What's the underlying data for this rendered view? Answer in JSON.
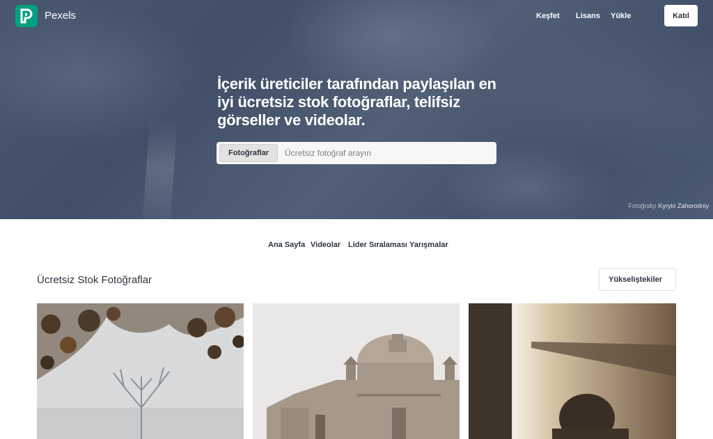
{
  "brand": {
    "name": "Pexels",
    "accent": "#05a081"
  },
  "topnav": {
    "links": [
      "Keşfet",
      "Lisans",
      "Yükle"
    ],
    "join_label": "Katıl"
  },
  "hero": {
    "headline": "İçerik üreticiler tarafından paylaşılan en iyi ücretsiz stok fotoğraflar, telifsiz görseller ve videolar.",
    "search": {
      "type_label": "Fotoğraflar",
      "placeholder": "Ücretsiz fotoğraf arayın",
      "value": ""
    },
    "credit": {
      "lead": "Fotoğrafçı",
      "name": "Kyrylo Zahorodniy"
    }
  },
  "subnav": {
    "items": [
      "Ana Sayfa",
      "Videolar",
      "Lider Sıralaması",
      "Yarışmalar"
    ]
  },
  "section": {
    "title": "Ücretsiz Stok Fotoğraflar",
    "sort_label": "Yükseliştekiler"
  },
  "photos": [
    {
      "name": "foggy-tree"
    },
    {
      "name": "stone-church"
    },
    {
      "name": "window-light"
    }
  ]
}
